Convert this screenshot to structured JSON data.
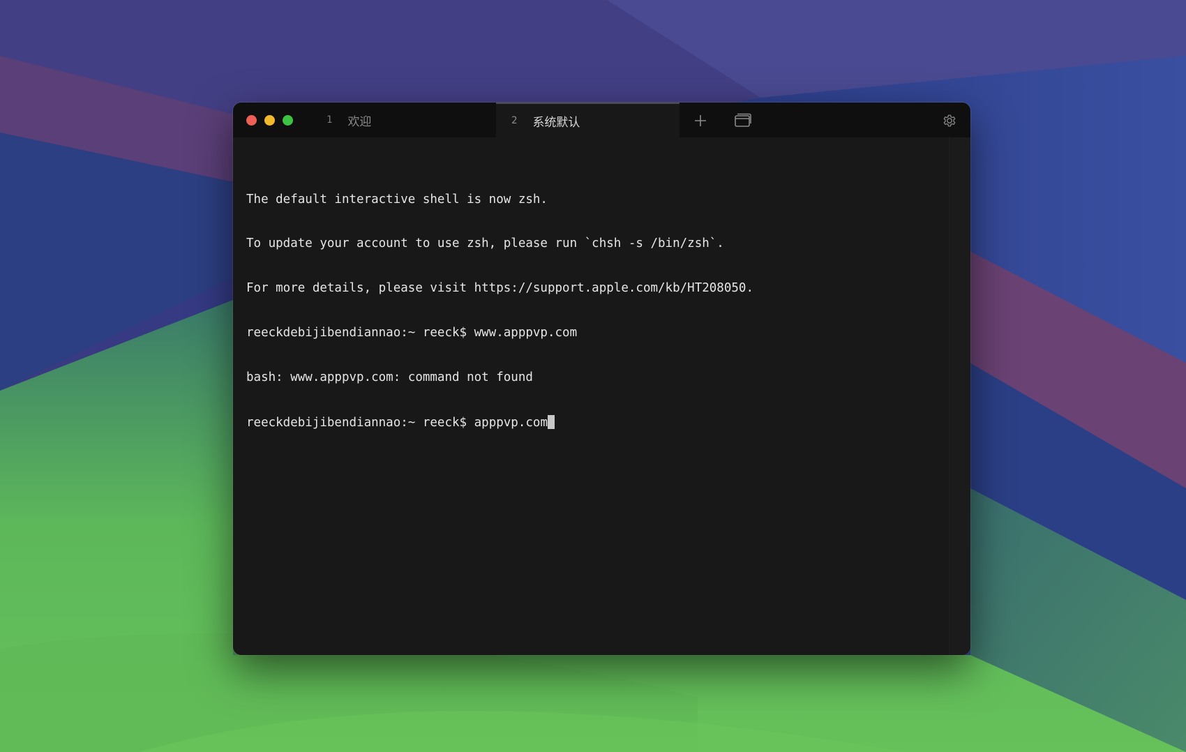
{
  "window": {
    "traffic_lights": [
      "close",
      "minimize",
      "zoom"
    ]
  },
  "tabs": [
    {
      "number": "1",
      "label": "欢迎",
      "active": false
    },
    {
      "number": "2",
      "label": "系统默认",
      "active": true
    }
  ],
  "toolbar": {
    "add_icon": "plus-icon",
    "overview_icon": "tabs-overview-icon",
    "settings_icon": "gear-icon"
  },
  "terminal": {
    "lines": [
      "The default interactive shell is now zsh.",
      "To update your account to use zsh, please run `chsh -s /bin/zsh`.",
      "For more details, please visit https://support.apple.com/kb/HT208050.",
      "reeckdebijibendiannao:~ reeck$ www.apppvp.com",
      "bash: www.apppvp.com: command not found"
    ],
    "prompt": "reeckdebijibendiannao:~ reeck$ ",
    "current_input": "apppvp.com"
  },
  "colors": {
    "close": "#ee5f57",
    "minimize": "#f2b92c",
    "zoom": "#3ec244",
    "terminal_bg": "#181818",
    "text": "#e6e6e6"
  }
}
